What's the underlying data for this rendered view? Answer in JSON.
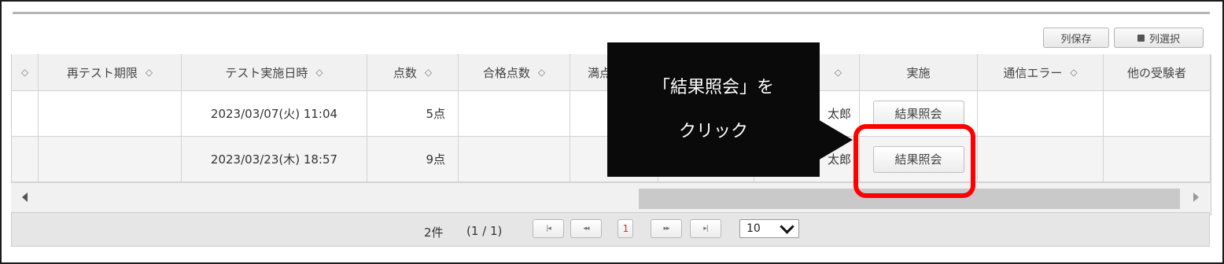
{
  "toolbar": {
    "save_columns": "列保存",
    "select_columns": "列選択"
  },
  "columns": [
    {
      "label": "",
      "sort_icon": "◇"
    },
    {
      "label": "再テスト期限",
      "sort_icon": "◇"
    },
    {
      "label": "テスト実施日時",
      "sort_icon": "◇"
    },
    {
      "label": "点数",
      "sort_icon": "◇"
    },
    {
      "label": "合格点数",
      "sort_icon": "◇"
    },
    {
      "label": "満点",
      "sort_icon": ""
    },
    {
      "label": "",
      "sort_icon": ""
    },
    {
      "label": "",
      "sort_icon": "◇"
    },
    {
      "label": "実施",
      "sort_icon": ""
    },
    {
      "label": "通信エラー",
      "sort_icon": "◇"
    },
    {
      "label": "他の受験者",
      "sort_icon": ""
    }
  ],
  "rows": [
    {
      "retest_deadline": "",
      "test_datetime": "2023/03/07(火) 11:04",
      "score": "5点",
      "pass_score": "",
      "name_partial": "太郎",
      "action": "結果照会"
    },
    {
      "retest_deadline": "",
      "test_datetime": "2023/03/23(木) 18:57",
      "score": "9点",
      "pass_score": "",
      "name_partial": "太郎",
      "action": "結果照会"
    }
  ],
  "pager": {
    "count": "2件",
    "pages": "(1 / 1)",
    "first": "|◂",
    "prev": "◂◂",
    "current": "1",
    "next": "▸▸",
    "last": "▸|",
    "page_size": "10"
  },
  "callout": {
    "line1": "「結果照会」を",
    "line2": "クリック"
  },
  "colors": {
    "highlight": "#ff0000",
    "callout_bg": "#0a0a0a"
  }
}
